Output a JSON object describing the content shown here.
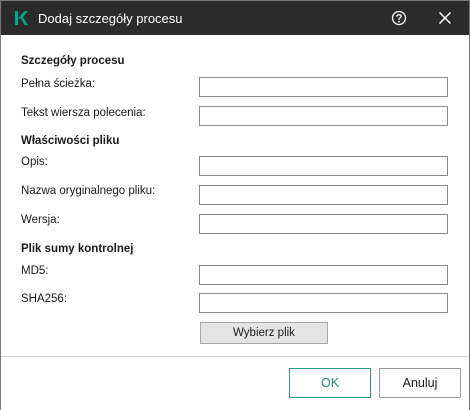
{
  "window": {
    "title": "Dodaj szczegóły procesu",
    "logo_icon": "kaspersky-k-logo-icon",
    "help_icon": "help-circle-icon",
    "close_icon": "close-icon"
  },
  "sections": {
    "process_details": {
      "header": "Szczegóły procesu",
      "full_path_label": "Pełna ścieżka:",
      "full_path_value": "",
      "command_line_label": "Tekst wiersza polecenia:",
      "command_line_value": ""
    },
    "file_properties": {
      "header": "Właściwości pliku",
      "description_label": "Opis:",
      "description_value": "",
      "original_name_label": "Nazwa oryginalnego pliku:",
      "original_name_value": "",
      "version_label": "Wersja:",
      "version_value": ""
    },
    "checksum": {
      "header": "Plik sumy kontrolnej",
      "md5_label": "MD5:",
      "md5_value": "",
      "sha256_label": "SHA256:",
      "sha256_value": "",
      "browse_label": "Wybierz plik"
    }
  },
  "footer": {
    "ok_label": "OK",
    "cancel_label": "Anuluj"
  },
  "colors": {
    "titlebar": "#2b2b2b",
    "accent": "#1e8c75",
    "logo": "#00a88e"
  }
}
